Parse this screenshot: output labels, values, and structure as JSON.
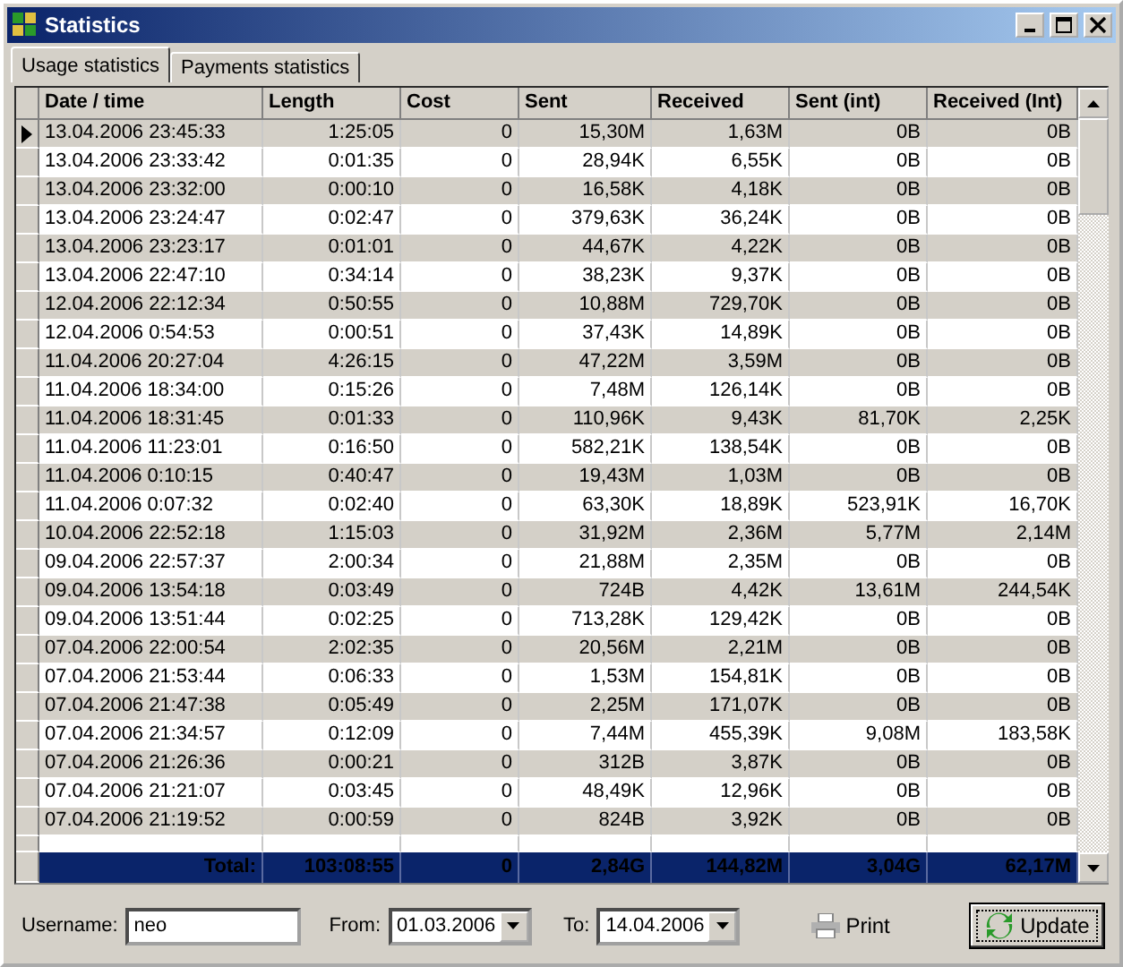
{
  "window": {
    "title": "Statistics"
  },
  "tabs": [
    {
      "label": "Usage statistics",
      "selected": true
    },
    {
      "label": "Payments statistics",
      "selected": false
    }
  ],
  "table": {
    "columns": [
      "Date / time",
      "Length",
      "Cost",
      "Sent",
      "Received",
      "Sent (int)",
      "Received (Int)"
    ],
    "rows": [
      {
        "selected": true,
        "cells": [
          "13.04.2006 23:45:33",
          "1:25:05",
          "0",
          "15,30M",
          "1,63M",
          "0B",
          "0B"
        ]
      },
      {
        "selected": false,
        "cells": [
          "13.04.2006 23:33:42",
          "0:01:35",
          "0",
          "28,94K",
          "6,55K",
          "0B",
          "0B"
        ]
      },
      {
        "selected": false,
        "cells": [
          "13.04.2006 23:32:00",
          "0:00:10",
          "0",
          "16,58K",
          "4,18K",
          "0B",
          "0B"
        ]
      },
      {
        "selected": false,
        "cells": [
          "13.04.2006 23:24:47",
          "0:02:47",
          "0",
          "379,63K",
          "36,24K",
          "0B",
          "0B"
        ]
      },
      {
        "selected": false,
        "cells": [
          "13.04.2006 23:23:17",
          "0:01:01",
          "0",
          "44,67K",
          "4,22K",
          "0B",
          "0B"
        ]
      },
      {
        "selected": false,
        "cells": [
          "13.04.2006 22:47:10",
          "0:34:14",
          "0",
          "38,23K",
          "9,37K",
          "0B",
          "0B"
        ]
      },
      {
        "selected": false,
        "cells": [
          "12.04.2006 22:12:34",
          "0:50:55",
          "0",
          "10,88M",
          "729,70K",
          "0B",
          "0B"
        ]
      },
      {
        "selected": false,
        "cells": [
          "12.04.2006 0:54:53",
          "0:00:51",
          "0",
          "37,43K",
          "14,89K",
          "0B",
          "0B"
        ]
      },
      {
        "selected": false,
        "cells": [
          "11.04.2006 20:27:04",
          "4:26:15",
          "0",
          "47,22M",
          "3,59M",
          "0B",
          "0B"
        ]
      },
      {
        "selected": false,
        "cells": [
          "11.04.2006 18:34:00",
          "0:15:26",
          "0",
          "7,48M",
          "126,14K",
          "0B",
          "0B"
        ]
      },
      {
        "selected": false,
        "cells": [
          "11.04.2006 18:31:45",
          "0:01:33",
          "0",
          "110,96K",
          "9,43K",
          "81,70K",
          "2,25K"
        ]
      },
      {
        "selected": false,
        "cells": [
          "11.04.2006 11:23:01",
          "0:16:50",
          "0",
          "582,21K",
          "138,54K",
          "0B",
          "0B"
        ]
      },
      {
        "selected": false,
        "cells": [
          "11.04.2006 0:10:15",
          "0:40:47",
          "0",
          "19,43M",
          "1,03M",
          "0B",
          "0B"
        ]
      },
      {
        "selected": false,
        "cells": [
          "11.04.2006 0:07:32",
          "0:02:40",
          "0",
          "63,30K",
          "18,89K",
          "523,91K",
          "16,70K"
        ]
      },
      {
        "selected": false,
        "cells": [
          "10.04.2006 22:52:18",
          "1:15:03",
          "0",
          "31,92M",
          "2,36M",
          "5,77M",
          "2,14M"
        ]
      },
      {
        "selected": false,
        "cells": [
          "09.04.2006 22:57:37",
          "2:00:34",
          "0",
          "21,88M",
          "2,35M",
          "0B",
          "0B"
        ]
      },
      {
        "selected": false,
        "cells": [
          "09.04.2006 13:54:18",
          "0:03:49",
          "0",
          "724B",
          "4,42K",
          "13,61M",
          "244,54K"
        ]
      },
      {
        "selected": false,
        "cells": [
          "09.04.2006 13:51:44",
          "0:02:25",
          "0",
          "713,28K",
          "129,42K",
          "0B",
          "0B"
        ]
      },
      {
        "selected": false,
        "cells": [
          "07.04.2006 22:00:54",
          "2:02:35",
          "0",
          "20,56M",
          "2,21M",
          "0B",
          "0B"
        ]
      },
      {
        "selected": false,
        "cells": [
          "07.04.2006 21:53:44",
          "0:06:33",
          "0",
          "1,53M",
          "154,81K",
          "0B",
          "0B"
        ]
      },
      {
        "selected": false,
        "cells": [
          "07.04.2006 21:47:38",
          "0:05:49",
          "0",
          "2,25M",
          "171,07K",
          "0B",
          "0B"
        ]
      },
      {
        "selected": false,
        "cells": [
          "07.04.2006 21:34:57",
          "0:12:09",
          "0",
          "7,44M",
          "455,39K",
          "9,08M",
          "183,58K"
        ]
      },
      {
        "selected": false,
        "cells": [
          "07.04.2006 21:26:36",
          "0:00:21",
          "0",
          "312B",
          "3,87K",
          "0B",
          "0B"
        ]
      },
      {
        "selected": false,
        "cells": [
          "07.04.2006 21:21:07",
          "0:03:45",
          "0",
          "48,49K",
          "12,96K",
          "0B",
          "0B"
        ]
      },
      {
        "selected": false,
        "cells": [
          "07.04.2006 21:19:52",
          "0:00:59",
          "0",
          "824B",
          "3,92K",
          "0B",
          "0B"
        ]
      }
    ],
    "totals": [
      "Total:",
      "103:08:55",
      "0",
      "2,84G",
      "144,82M",
      "3,04G",
      "62,17M"
    ]
  },
  "filters": {
    "username": {
      "label": "Username:",
      "value": "neo"
    },
    "from": {
      "label": "From:",
      "value": "01.03.2006"
    },
    "to": {
      "label": "To:",
      "value": "14.04.2006"
    }
  },
  "buttons": {
    "print": "Print",
    "update": "Update"
  }
}
